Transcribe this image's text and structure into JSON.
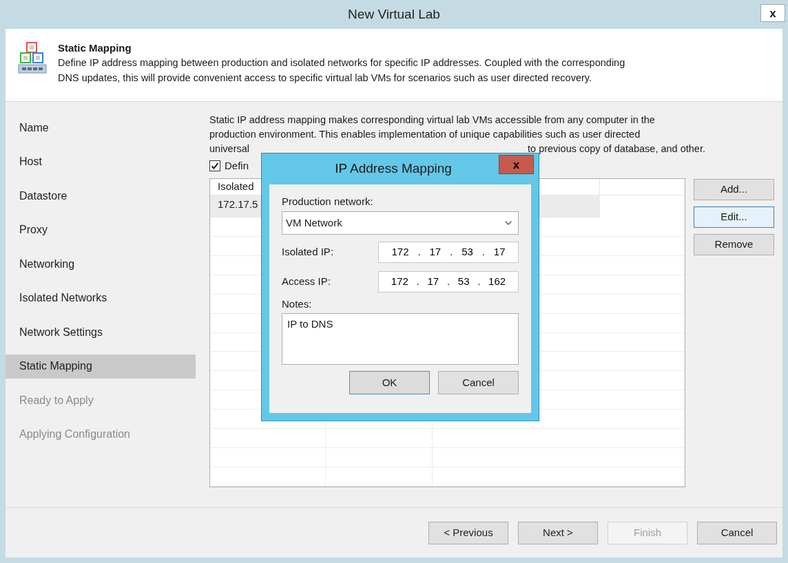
{
  "window": {
    "title": "New Virtual Lab",
    "close": "x"
  },
  "header": {
    "title": "Static Mapping",
    "lines": [
      "Define IP address mapping between production and isolated networks for specific IP addresses. Coupled with the corresponding",
      "DNS updates, this will provide convenient access to specific virtual lab VMs for scenarios such as user directed recovery."
    ]
  },
  "sidebar": {
    "items": [
      {
        "label": "Name",
        "selected": false,
        "disabled": false
      },
      {
        "label": "Host",
        "selected": false,
        "disabled": false
      },
      {
        "label": "Datastore",
        "selected": false,
        "disabled": false
      },
      {
        "label": "Proxy",
        "selected": false,
        "disabled": false
      },
      {
        "label": "Networking",
        "selected": false,
        "disabled": false
      },
      {
        "label": "Isolated Networks",
        "selected": false,
        "disabled": false
      },
      {
        "label": "Network Settings",
        "selected": false,
        "disabled": false
      },
      {
        "label": "Static Mapping",
        "selected": true,
        "disabled": false
      },
      {
        "label": "Ready to Apply",
        "selected": false,
        "disabled": true
      },
      {
        "label": "Applying Configuration",
        "selected": false,
        "disabled": true
      }
    ]
  },
  "content": {
    "lines": [
      "Static IP address mapping makes corresponding virtual lab VMs accessible from any computer in the",
      "production environment. This enables implementation of unique capabilities such as user directed"
    ],
    "last_line_parts": [
      "universal",
      "to previous copy of database, and other."
    ],
    "checkbox": {
      "label": "Defin",
      "checked": true
    }
  },
  "table": {
    "columns": [
      "Isolated"
    ],
    "rows": [
      {
        "cells": [
          "172.17.5"
        ],
        "selected": true
      }
    ]
  },
  "side_buttons": [
    {
      "label": "Add...",
      "focused": false
    },
    {
      "label": "Edit...",
      "focused": true
    },
    {
      "label": "Remove",
      "focused": false
    }
  ],
  "footer_buttons": [
    {
      "label": "< Previous",
      "disabled": false
    },
    {
      "label": "Next >",
      "disabled": false
    },
    {
      "label": "Finish",
      "disabled": true
    },
    {
      "label": "Cancel",
      "disabled": false
    }
  ],
  "dialog": {
    "title": "IP Address Mapping",
    "close": "x",
    "production_network_label": "Production network:",
    "production_network": "VM Network",
    "separator": ".",
    "isolated_ip_label": "Isolated IP:",
    "isolated_ip": [
      "172",
      "17",
      "53",
      "17"
    ],
    "access_ip_label": "Access IP:",
    "access_ip": [
      "172",
      "17",
      "53",
      "162"
    ],
    "notes_label": "Notes:",
    "notes": "IP to DNS",
    "buttons": [
      {
        "label": "OK",
        "default": true
      },
      {
        "label": "Cancel",
        "default": false
      }
    ]
  }
}
